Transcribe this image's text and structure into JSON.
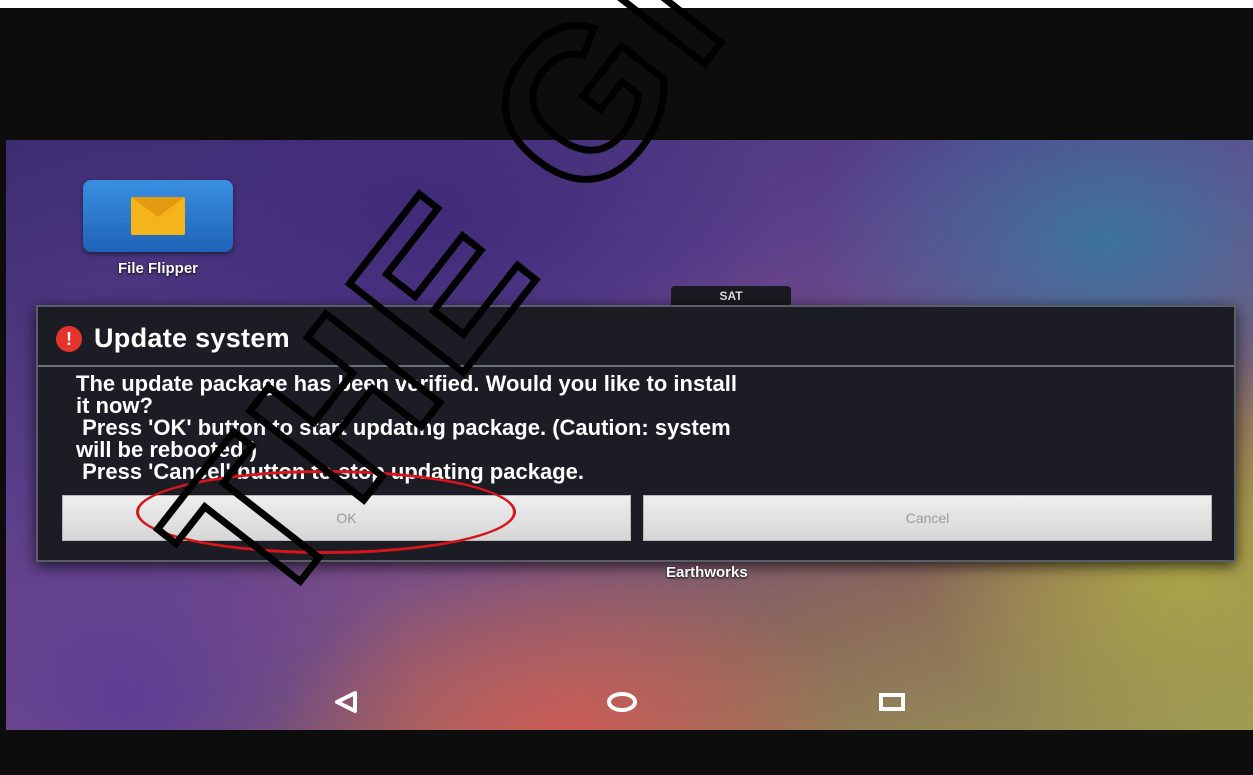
{
  "desktop": {
    "app_icon_label": "File Flipper",
    "peek_label": "SAT",
    "bottom_app_label": "Earthworks"
  },
  "dialog": {
    "title": "Update system",
    "alert_symbol": "!",
    "message_lines": [
      "The update package has been verified. Would you like to install",
      "it now?",
      " Press 'OK' button to start updating package. (Caution: system",
      "will be rebooted.)",
      " Press 'Cancel' button to stop updating package."
    ],
    "ok_label": "OK",
    "cancel_label": "Cancel"
  },
  "navbar": {
    "back_icon": "back-triangle-icon",
    "home_icon": "home-circle-icon",
    "recents_icon": "recents-square-icon"
  },
  "overlay": {
    "watermark_text": "THE GNSS",
    "highlight_color": "#d8141c"
  }
}
